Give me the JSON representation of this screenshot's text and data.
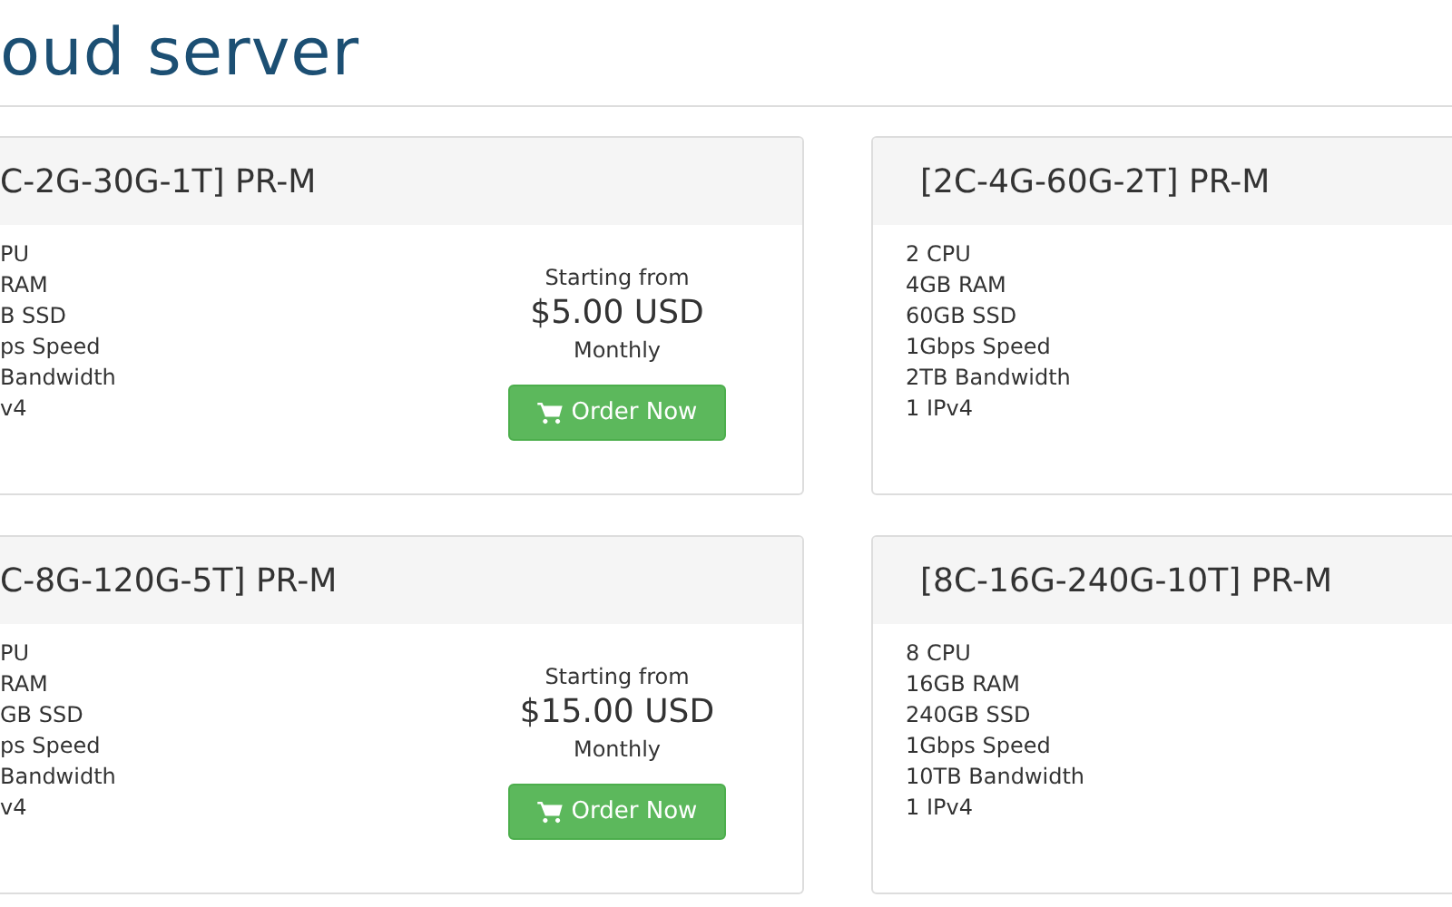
{
  "title": "oud server",
  "plans": [
    {
      "name": "C-2G-30G-1T] PR-M",
      "specs": [
        "PU",
        "RAM",
        "B SSD",
        "ps Speed",
        "Bandwidth",
        "v4"
      ],
      "price": {
        "label": "Starting from",
        "amount": "$5.00 USD",
        "period": "Monthly",
        "button": "Order Now"
      }
    },
    {
      "name": "[2C-4G-60G-2T] PR-M",
      "specs": [
        "2 CPU",
        "4GB RAM",
        "60GB SSD",
        "1Gbps Speed",
        "2TB Bandwidth",
        "1 IPv4"
      ]
    },
    {
      "name": "C-8G-120G-5T] PR-M",
      "specs": [
        "PU",
        "RAM",
        "GB SSD",
        "ps Speed",
        "Bandwidth",
        "v4"
      ],
      "price": {
        "label": "Starting from",
        "amount": "$15.00 USD",
        "period": "Monthly",
        "button": "Order Now"
      }
    },
    {
      "name": "[8C-16G-240G-10T] PR-M",
      "specs": [
        "8 CPU",
        "16GB RAM",
        "240GB SSD",
        "1Gbps Speed",
        "10TB Bandwidth",
        "1 IPv4"
      ]
    }
  ]
}
